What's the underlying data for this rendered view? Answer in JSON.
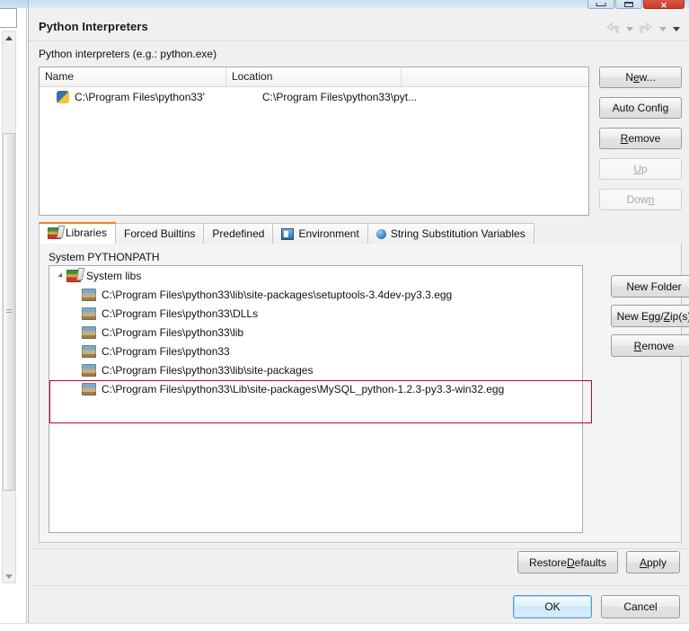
{
  "window": {
    "title": "Python Interpreters",
    "buttons": {
      "minimize": "minimize-button",
      "maximize": "maximize-button",
      "close_glyph": "✕"
    }
  },
  "nav": {
    "back": "back-arrow",
    "back_dropdown": "back-dropdown",
    "forward": "forward-arrow",
    "forward_dropdown": "forward-dropdown",
    "menu_dropdown": "view-menu-dropdown"
  },
  "header": {
    "page_title": "Python Interpreters",
    "description": "Python interpreters (e.g.: python.exe)"
  },
  "interpreter_table": {
    "columns": [
      "Name",
      "Location",
      ""
    ],
    "rows": [
      {
        "icon": "python-icon",
        "name": "C:\\Program Files\\python33'",
        "location": "C:\\Program Files\\python33\\pyt..."
      }
    ]
  },
  "interpreter_buttons": [
    {
      "label": "New...",
      "accel": "w",
      "disabled": false,
      "name": "new-button"
    },
    {
      "label": "Auto Config",
      "accel": "",
      "disabled": false,
      "name": "auto-config-button"
    },
    {
      "label": "Remove",
      "accel": "R",
      "disabled": false,
      "name": "remove-button"
    },
    {
      "label": "Up",
      "accel": "U",
      "disabled": true,
      "name": "up-button"
    },
    {
      "label": "Down",
      "accel": "n",
      "disabled": true,
      "name": "down-button"
    }
  ],
  "tabs": [
    {
      "label": "Libraries",
      "icon": "books-icon",
      "active": true
    },
    {
      "label": "Forced Builtins",
      "icon": "",
      "active": false
    },
    {
      "label": "Predefined",
      "icon": "",
      "active": false
    },
    {
      "label": "Environment",
      "icon": "environment-icon",
      "active": false
    },
    {
      "label": "String Substitution Variables",
      "icon": "blue-dot-icon",
      "active": false
    }
  ],
  "libraries": {
    "section_label": "System PYTHONPATH",
    "tree": {
      "root": {
        "label": "System libs",
        "icon": "books-icon",
        "expanded": true
      },
      "children": [
        {
          "icon": "library-icon",
          "label": "C:\\Program Files\\python33\\lib\\site-packages\\setuptools-3.4dev-py3.3.egg",
          "highlighted": false
        },
        {
          "icon": "library-icon",
          "label": "C:\\Program Files\\python33\\DLLs",
          "highlighted": false
        },
        {
          "icon": "library-icon",
          "label": "C:\\Program Files\\python33\\lib",
          "highlighted": false
        },
        {
          "icon": "library-icon",
          "label": "C:\\Program Files\\python33",
          "highlighted": false
        },
        {
          "icon": "library-icon",
          "label": "C:\\Program Files\\python33\\lib\\site-packages",
          "highlighted": false
        },
        {
          "icon": "library-icon",
          "label": "C:\\Program Files\\python33\\Lib\\site-packages\\MySQL_python-1.2.3-py3.3-win32.egg",
          "highlighted": true
        }
      ]
    },
    "buttons": [
      {
        "label": "New Folder",
        "accel": "",
        "disabled": false,
        "name": "new-folder-button"
      },
      {
        "label": "New Egg/Zip(s)",
        "accel": "Z",
        "disabled": false,
        "name": "new-egg-zip-button"
      },
      {
        "label": "Remove",
        "accel": "R",
        "disabled": false,
        "name": "remove-library-button"
      }
    ],
    "highlight_color": "#c4002b"
  },
  "footer": {
    "restore_defaults": "Restore Defaults",
    "restore_defaults_accel": "D",
    "apply": "Apply",
    "apply_accel": "A",
    "ok": "OK",
    "cancel": "Cancel"
  },
  "colors": {
    "accent_tab": "#f58220",
    "ok_focus": "#4c9fd6",
    "highlight": "#c4002b",
    "titlebar": "#c9def2"
  }
}
